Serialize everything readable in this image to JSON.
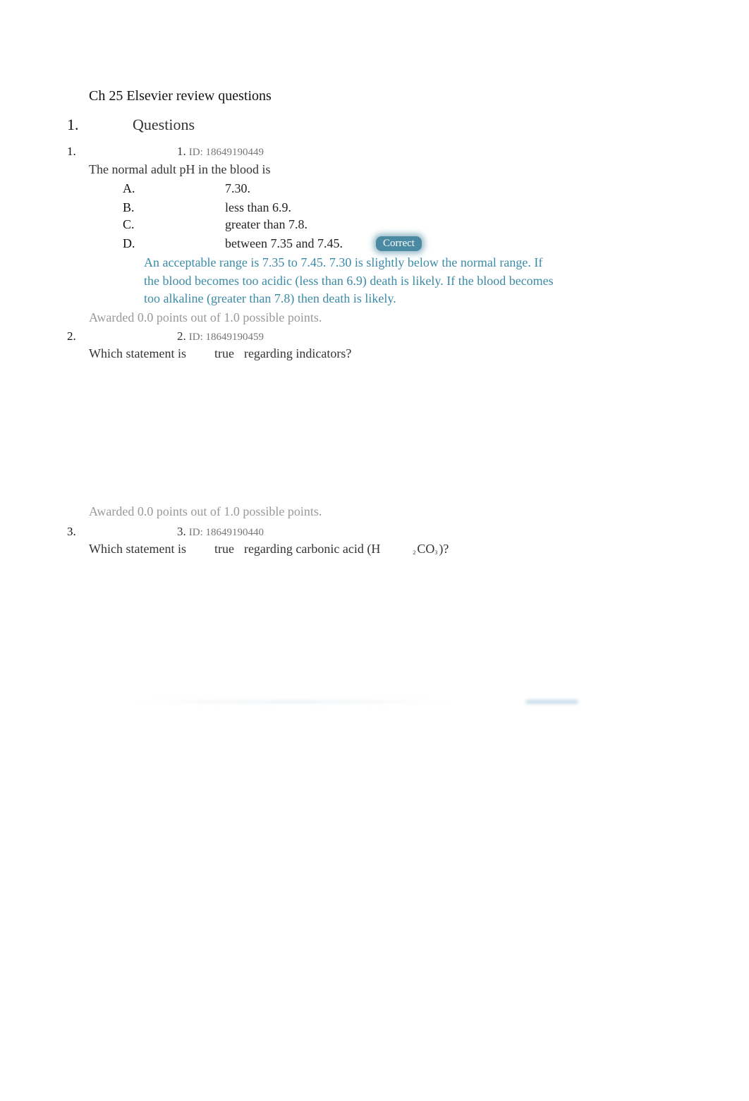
{
  "document": {
    "title": "Ch 25 Elsevier review questions",
    "section": {
      "number": "1.",
      "title": "Questions"
    }
  },
  "questions": [
    {
      "outer_number": "1.",
      "inner_number": "1.",
      "id_label": "ID: 18649190449",
      "text": "The normal adult pH in the blood is",
      "options": [
        {
          "letter": "A.",
          "text": "7.30."
        },
        {
          "letter": "B.",
          "text": "less than 6.9."
        },
        {
          "letter": "C.",
          "text": "greater than 7.8."
        },
        {
          "letter": "D.",
          "text": "between 7.35 and 7.45.",
          "badge": "Correct"
        }
      ],
      "rationale": "An acceptable range is 7.35 to 7.45. 7.30 is slightly below the normal range. If the blood becomes too acidic (less than 6.9) death is likely. If the blood becomes too alkaline (greater than 7.8) then death is likely.",
      "awarded": "Awarded 0.0 points out of 1.0 possible points."
    },
    {
      "outer_number": "2.",
      "inner_number": "2.",
      "id_label": "ID: 18649190459",
      "text_parts": [
        "Which statement is",
        "true",
        "regarding indicators?"
      ],
      "awarded": "Awarded 0.0 points out of 1.0 possible points."
    },
    {
      "outer_number": "3.",
      "inner_number": "3.",
      "id_label": "ID: 18649190440",
      "text_parts": [
        "Which statement is",
        "true",
        "regarding carbonic acid (H",
        "2",
        "CO",
        "3",
        ")?"
      ]
    }
  ],
  "colors": {
    "rationale": "#3b8ba8",
    "correct_badge": "#4a8aa3",
    "awarded": "#999999",
    "id_label": "#777777"
  }
}
